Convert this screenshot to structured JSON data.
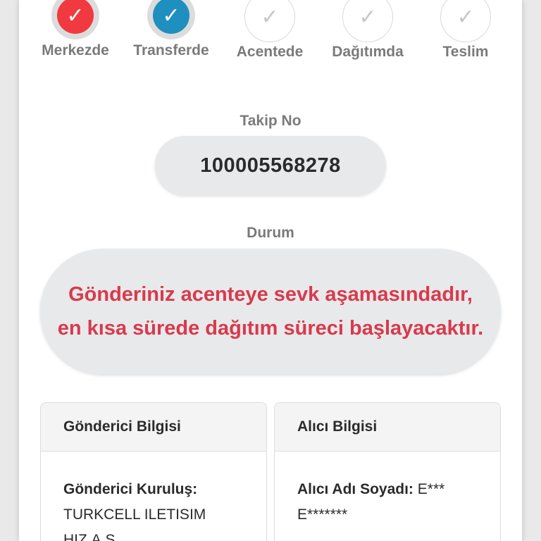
{
  "steps": [
    {
      "label": "Merkezde",
      "state": "done",
      "color": "#f03a3f",
      "icon": "check-icon"
    },
    {
      "label": "Transferde",
      "state": "done",
      "color": "#1f8fbf",
      "icon": "check-icon"
    },
    {
      "label": "Acentede",
      "state": "pending",
      "icon": "check-icon"
    },
    {
      "label": "Dağıtımda",
      "state": "pending",
      "icon": "check-icon"
    },
    {
      "label": "Teslim",
      "state": "pending",
      "icon": "check-icon"
    }
  ],
  "check_glyph": "✓",
  "tracking": {
    "label": "Takip No",
    "number": "100005568278"
  },
  "status": {
    "label": "Durum",
    "message": "Gönderiniz acenteye sevk aşamasındadır, en kısa sürede dağıtım süreci başlayacaktır.",
    "color": "#d83a4c"
  },
  "sender": {
    "title": "Gönderici Bilgisi",
    "key": "Gönderici Kuruluş:",
    "value": "TURKCELL ILETISIM HIZ.A.S."
  },
  "receiver": {
    "title": "Alıcı Bilgisi",
    "key": "Alıcı Adı Soyadı:",
    "value": "E*** E*******"
  }
}
